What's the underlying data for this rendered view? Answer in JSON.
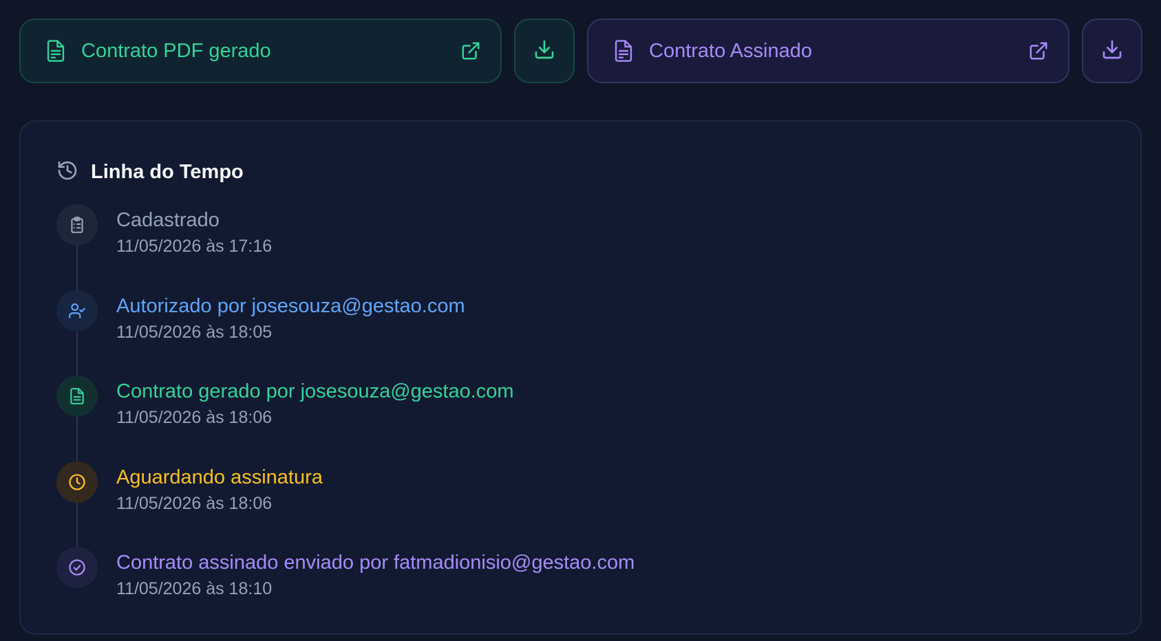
{
  "actions": {
    "generated_pdf": {
      "label": "Contrato PDF gerado",
      "color": "#34d399"
    },
    "signed_contract": {
      "label": "Contrato Assinado",
      "color": "#a78bfa"
    }
  },
  "timeline": {
    "title": "Linha do Tempo",
    "events": [
      {
        "icon": "clipboard-icon",
        "title": "Cadastrado",
        "time": "11/05/2026 às 17:16",
        "color": "#94a3b8"
      },
      {
        "icon": "user-check-icon",
        "title": "Autorizado por josesouza@gestao.com",
        "time": "11/05/2026 às 18:05",
        "color": "#60a5fa"
      },
      {
        "icon": "file-text-icon",
        "title": "Contrato gerado por josesouza@gestao.com",
        "time": "11/05/2026 às 18:06",
        "color": "#34d399"
      },
      {
        "icon": "clock-icon",
        "title": "Aguardando assinatura",
        "time": "11/05/2026 às 18:06",
        "color": "#fbbf24"
      },
      {
        "icon": "check-circle-icon",
        "title": "Contrato assinado enviado por fatmadionisio@gestao.com",
        "time": "11/05/2026 às 18:10",
        "color": "#a78bfa"
      }
    ]
  }
}
